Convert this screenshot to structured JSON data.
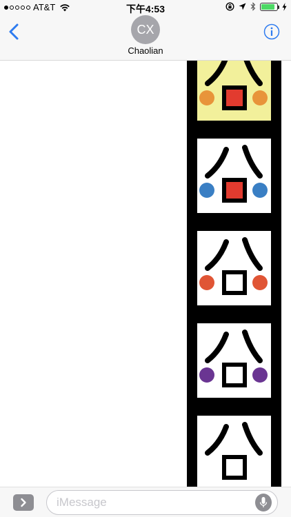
{
  "status_bar": {
    "carrier": "AT&T",
    "time": "下午4:53",
    "signal_bars_filled": 1,
    "signal_bars_total": 5,
    "battery_level": 0.85,
    "icons": [
      "wifi-icon",
      "rotation-lock-icon",
      "location-icon",
      "bluetooth-icon",
      "battery-icon",
      "charging-icon"
    ]
  },
  "header": {
    "avatar_initials": "CX",
    "contact_name": "Chaolian",
    "icons": [
      "back-chevron-icon",
      "info-icon"
    ]
  },
  "stickers": [
    {
      "face_color": "#f2f09b",
      "cheek_color": "#e8943a",
      "mouth_fill": "#e23b2f"
    },
    {
      "face_color": "#ffffff",
      "cheek_color": "#3a7fc4",
      "mouth_fill": "#e23b2f"
    },
    {
      "face_color": "#ffffff",
      "cheek_color": "#e05535",
      "mouth_fill": "#ffffff"
    },
    {
      "face_color": "#ffffff",
      "cheek_color": "#6a3592",
      "mouth_fill": "#ffffff"
    },
    {
      "face_color": "#ffffff",
      "cheek_color": "#ffffff",
      "mouth_fill": "#ffffff"
    }
  ],
  "input_bar": {
    "placeholder": "iMessage",
    "icons": [
      "chevron-right-icon",
      "microphone-icon"
    ]
  },
  "colors": {
    "accent": "#2d7bf0",
    "battery": "#4cd964",
    "bar_background": "#f7f7f7"
  }
}
